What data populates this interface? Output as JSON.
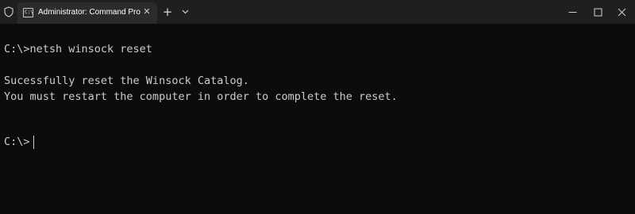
{
  "window": {
    "tab_title": "Administrator: Command Pro",
    "tab_icon_text": "C:\\",
    "close_tab_glyph": "✕",
    "new_tab_glyph": "+"
  },
  "icons": {
    "shield": "shield-icon",
    "terminal": "terminal-icon",
    "close": "close-icon",
    "plus": "plus-icon",
    "chevron": "chevron-down-icon",
    "minimize": "minimize-icon",
    "maximize": "maximize-icon"
  },
  "console": {
    "lines": [
      "C:\\>netsh winsock reset",
      "Sucessfully reset the Winsock Catalog.",
      "You must restart the computer in order to complete the reset.",
      "C:\\>"
    ]
  },
  "colors": {
    "titlebar_bg": "#1f1f1f",
    "tab_bg": "#2b2b2b",
    "console_bg": "#0c0c0c",
    "console_text": "#cccccc"
  }
}
